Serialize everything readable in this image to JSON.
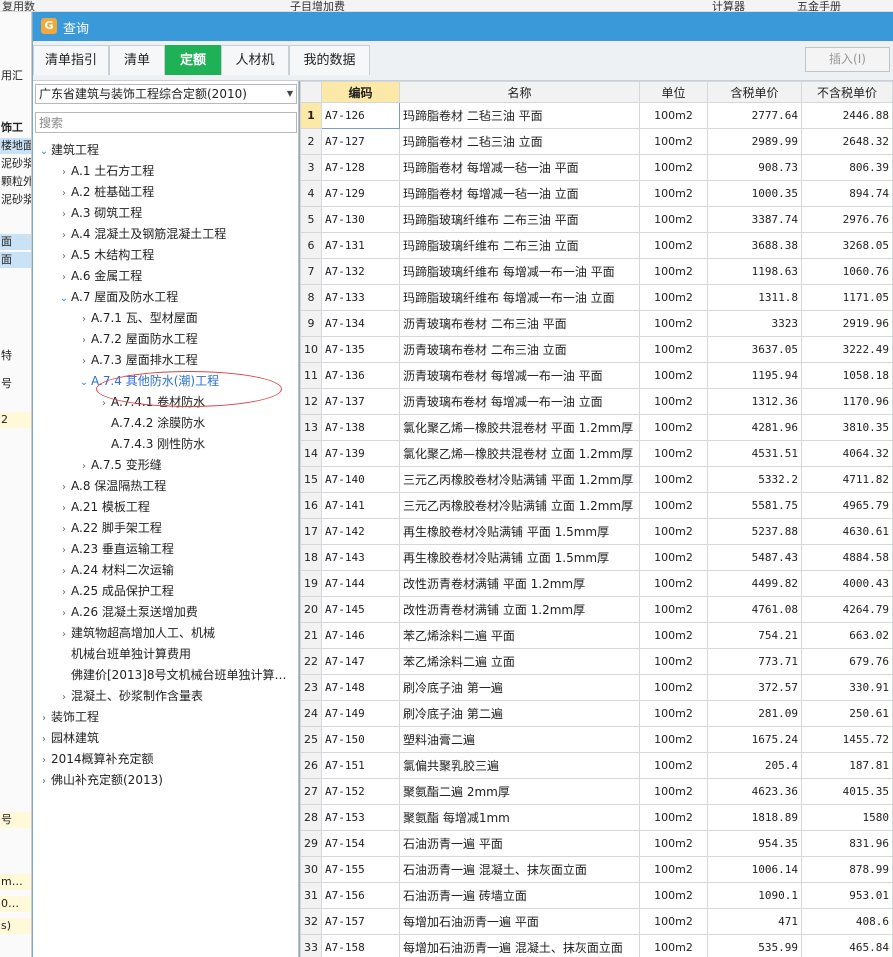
{
  "dialog": {
    "title": "查询"
  },
  "background": {
    "toolbar_items": [
      "复用数",
      "子目增加费",
      "计算器",
      "五金手册"
    ],
    "left_labels": [
      "用汇",
      "饰工",
      "楼地面",
      "泥砂浆",
      "颗粒外",
      "泥砂浆",
      "面",
      "面",
      "特",
      "号",
      "2",
      "号",
      "m…",
      "0…",
      "s)"
    ]
  },
  "tabs": [
    {
      "label": "清单指引",
      "active": false
    },
    {
      "label": "清单",
      "active": false
    },
    {
      "label": "定额",
      "active": true
    },
    {
      "label": "人材机",
      "active": false
    },
    {
      "label": "我的数据",
      "active": false
    }
  ],
  "insert_button": "插入(I)",
  "left_panel": {
    "quota_select": "广东省建筑与装饰工程综合定额(2010)",
    "search_placeholder": "搜索"
  },
  "tree": [
    {
      "label": "建筑工程",
      "level": 0,
      "toggle": "open"
    },
    {
      "label": "A.1 土石方工程",
      "level": 1,
      "toggle": "closed"
    },
    {
      "label": "A.2 桩基础工程",
      "level": 1,
      "toggle": "closed"
    },
    {
      "label": "A.3 砌筑工程",
      "level": 1,
      "toggle": "closed"
    },
    {
      "label": "A.4 混凝土及钢筋混凝土工程",
      "level": 1,
      "toggle": "closed"
    },
    {
      "label": "A.5 木结构工程",
      "level": 1,
      "toggle": "closed"
    },
    {
      "label": "A.6 金属工程",
      "level": 1,
      "toggle": "closed"
    },
    {
      "label": "A.7 屋面及防水工程",
      "level": 1,
      "toggle": "open"
    },
    {
      "label": "A.7.1 瓦、型材屋面",
      "level": 2,
      "toggle": "closed"
    },
    {
      "label": "A.7.2 屋面防水工程",
      "level": 2,
      "toggle": "closed"
    },
    {
      "label": "A.7.3 屋面排水工程",
      "level": 2,
      "toggle": "closed"
    },
    {
      "label": "A.7.4 其他防水(潮)工程",
      "level": 2,
      "toggle": "open",
      "highlight": true
    },
    {
      "label": "A.7.4.1 卷材防水",
      "level": 3,
      "toggle": "closed"
    },
    {
      "label": "A.7.4.2 涂膜防水",
      "level": 3,
      "toggle": "none"
    },
    {
      "label": "A.7.4.3 刚性防水",
      "level": 3,
      "toggle": "none"
    },
    {
      "label": "A.7.5 变形缝",
      "level": 2,
      "toggle": "closed"
    },
    {
      "label": "A.8 保温隔热工程",
      "level": 1,
      "toggle": "closed"
    },
    {
      "label": "A.21 模板工程",
      "level": 1,
      "toggle": "closed"
    },
    {
      "label": "A.22 脚手架工程",
      "level": 1,
      "toggle": "closed"
    },
    {
      "label": "A.23 垂直运输工程",
      "level": 1,
      "toggle": "closed"
    },
    {
      "label": "A.24 材料二次运输",
      "level": 1,
      "toggle": "closed"
    },
    {
      "label": "A.25 成品保护工程",
      "level": 1,
      "toggle": "closed"
    },
    {
      "label": "A.26 混凝土泵送增加费",
      "level": 1,
      "toggle": "closed"
    },
    {
      "label": "建筑物超高增加人工、机械",
      "level": 1,
      "toggle": "closed"
    },
    {
      "label": "机械台班单独计算费用",
      "level": 1,
      "toggle": "none"
    },
    {
      "label": "佛建价[2013]8号文机械台班单独计算…",
      "level": 1,
      "toggle": "none"
    },
    {
      "label": "混凝土、砂浆制作含量表",
      "level": 1,
      "toggle": "closed"
    },
    {
      "label": "装饰工程",
      "level": 0,
      "toggle": "closed"
    },
    {
      "label": "园林建筑",
      "level": 0,
      "toggle": "closed"
    },
    {
      "label": "2014概算补充定额",
      "level": 0,
      "toggle": "closed"
    },
    {
      "label": "佛山补充定额(2013)",
      "level": 0,
      "toggle": "closed"
    }
  ],
  "table": {
    "headers": [
      "",
      "编码",
      "名称",
      "单位",
      "含税单价",
      "不含税单价"
    ],
    "rows": [
      [
        "1",
        "A7-126",
        "玛蹄脂卷材 二毡三油 平面",
        "100m2",
        "2777.64",
        "2446.88"
      ],
      [
        "2",
        "A7-127",
        "玛蹄脂卷材 二毡三油 立面",
        "100m2",
        "2989.99",
        "2648.32"
      ],
      [
        "3",
        "A7-128",
        "玛蹄脂卷材 每增减一毡一油 平面",
        "100m2",
        "908.73",
        "806.39"
      ],
      [
        "4",
        "A7-129",
        "玛蹄脂卷材 每增减一毡一油 立面",
        "100m2",
        "1000.35",
        "894.74"
      ],
      [
        "5",
        "A7-130",
        "玛蹄脂玻璃纤维布 二布三油 平面",
        "100m2",
        "3387.74",
        "2976.76"
      ],
      [
        "6",
        "A7-131",
        "玛蹄脂玻璃纤维布 二布三油 立面",
        "100m2",
        "3688.38",
        "3268.05"
      ],
      [
        "7",
        "A7-132",
        "玛蹄脂玻璃纤维布 每增减一布一油 平面",
        "100m2",
        "1198.63",
        "1060.76"
      ],
      [
        "8",
        "A7-133",
        "玛蹄脂玻璃纤维布 每增减一布一油 立面",
        "100m2",
        "1311.8",
        "1171.05"
      ],
      [
        "9",
        "A7-134",
        "沥青玻璃布卷材 二布三油 平面",
        "100m2",
        "3323",
        "2919.96"
      ],
      [
        "10",
        "A7-135",
        "沥青玻璃布卷材 二布三油 立面",
        "100m2",
        "3637.05",
        "3222.49"
      ],
      [
        "11",
        "A7-136",
        "沥青玻璃布卷材 每增减一布一油 平面",
        "100m2",
        "1195.94",
        "1058.18"
      ],
      [
        "12",
        "A7-137",
        "沥青玻璃布卷材 每增减一布一油 立面",
        "100m2",
        "1312.36",
        "1170.96"
      ],
      [
        "13",
        "A7-138",
        "氯化聚乙烯—橡胶共混卷材 平面 1.2mm厚",
        "100m2",
        "4281.96",
        "3810.35"
      ],
      [
        "14",
        "A7-139",
        "氯化聚乙烯—橡胶共混卷材 立面 1.2mm厚",
        "100m2",
        "4531.51",
        "4064.32"
      ],
      [
        "15",
        "A7-140",
        "三元乙丙橡胶卷材冷贴满铺 平面 1.2mm厚",
        "100m2",
        "5332.2",
        "4711.82"
      ],
      [
        "16",
        "A7-141",
        "三元乙丙橡胶卷材冷贴满铺 立面 1.2mm厚",
        "100m2",
        "5581.75",
        "4965.79"
      ],
      [
        "17",
        "A7-142",
        "再生橡胶卷材冷贴满铺 平面 1.5mm厚",
        "100m2",
        "5237.88",
        "4630.61"
      ],
      [
        "18",
        "A7-143",
        "再生橡胶卷材冷贴满铺 立面 1.5mm厚",
        "100m2",
        "5487.43",
        "4884.58"
      ],
      [
        "19",
        "A7-144",
        "改性沥青卷材满铺 平面 1.2mm厚",
        "100m2",
        "4499.82",
        "4000.43"
      ],
      [
        "20",
        "A7-145",
        "改性沥青卷材满铺 立面 1.2mm厚",
        "100m2",
        "4761.08",
        "4264.79"
      ],
      [
        "21",
        "A7-146",
        "苯乙烯涂料二遍 平面",
        "100m2",
        "754.21",
        "663.02"
      ],
      [
        "22",
        "A7-147",
        "苯乙烯涂料二遍 立面",
        "100m2",
        "773.71",
        "679.76"
      ],
      [
        "23",
        "A7-148",
        "刷冷底子油 第一遍",
        "100m2",
        "372.57",
        "330.91"
      ],
      [
        "24",
        "A7-149",
        "刷冷底子油 第二遍",
        "100m2",
        "281.09",
        "250.61"
      ],
      [
        "25",
        "A7-150",
        "塑料油膏二遍",
        "100m2",
        "1675.24",
        "1455.72"
      ],
      [
        "26",
        "A7-151",
        "氯偏共聚乳胶三遍",
        "100m2",
        "205.4",
        "187.81"
      ],
      [
        "27",
        "A7-152",
        "聚氨酯二遍 2mm厚",
        "100m2",
        "4623.36",
        "4015.35"
      ],
      [
        "28",
        "A7-153",
        "聚氨酯 每增减1mm",
        "100m2",
        "1818.89",
        "1580"
      ],
      [
        "29",
        "A7-154",
        "石油沥青一遍 平面",
        "100m2",
        "954.35",
        "831.96"
      ],
      [
        "30",
        "A7-155",
        "石油沥青一遍 混凝土、抹灰面立面",
        "100m2",
        "1006.14",
        "878.99"
      ],
      [
        "31",
        "A7-156",
        "石油沥青一遍 砖墙立面",
        "100m2",
        "1090.1",
        "953.01"
      ],
      [
        "32",
        "A7-157",
        "每增加石油沥青一遍 平面",
        "100m2",
        "471",
        "408.6"
      ],
      [
        "33",
        "A7-158",
        "每增加石油沥青一遍 混凝土、抹灰面立面",
        "100m2",
        "535.99",
        "465.84"
      ]
    ]
  }
}
